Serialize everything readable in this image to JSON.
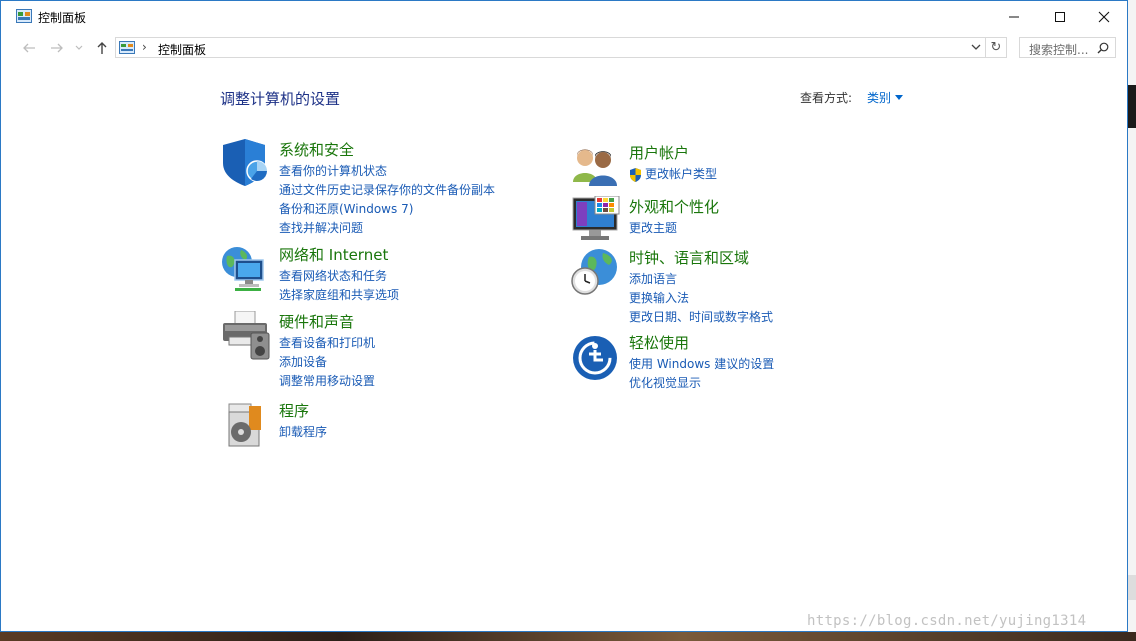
{
  "window": {
    "title": "控制面板"
  },
  "nav": {
    "address_text": "控制面板",
    "search_placeholder": "搜索控制..."
  },
  "content": {
    "heading": "调整计算机的设置",
    "view_by_label": "查看方式:",
    "view_by_value": "类别"
  },
  "categories": {
    "security": {
      "title": "系统和安全",
      "links": [
        "查看你的计算机状态",
        "通过文件历史记录保存你的文件备份副本",
        "备份和还原(Windows 7)",
        "查找并解决问题"
      ]
    },
    "network": {
      "title": "网络和 Internet",
      "links": [
        "查看网络状态和任务",
        "选择家庭组和共享选项"
      ]
    },
    "hardware": {
      "title": "硬件和声音",
      "links": [
        "查看设备和打印机",
        "添加设备",
        "调整常用移动设置"
      ]
    },
    "programs": {
      "title": "程序",
      "links": [
        "卸载程序"
      ]
    },
    "users": {
      "title": "用户帐户",
      "links": [
        "更改帐户类型"
      ]
    },
    "appearance": {
      "title": "外观和个性化",
      "links": [
        "更改主题"
      ]
    },
    "clock": {
      "title": "时钟、语言和区域",
      "links": [
        "添加语言",
        "更换输入法",
        "更改日期、时间或数字格式"
      ]
    },
    "ease": {
      "title": "轻松使用",
      "links": [
        "使用 Windows 建议的设置",
        "优化视觉显示"
      ]
    }
  },
  "watermark": "https://blog.csdn.net/yujing1314",
  "colors": {
    "accent": "#2b79c5",
    "category_title": "#19760b",
    "link": "#1a5bb5",
    "heading": "#1e3287"
  }
}
